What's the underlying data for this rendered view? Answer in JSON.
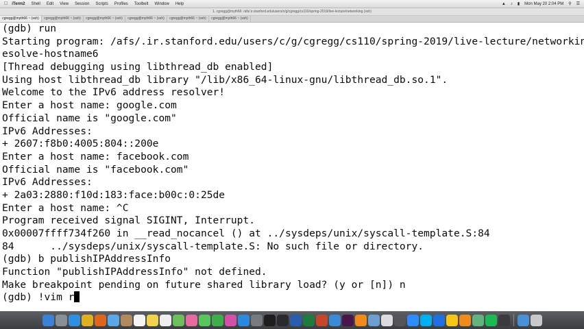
{
  "menubar": {
    "apple": "",
    "items": [
      {
        "label": "iTerm2",
        "name": "menu-iterm2"
      },
      {
        "label": "Shell",
        "name": "menu-shell"
      },
      {
        "label": "Edit",
        "name": "menu-edit"
      },
      {
        "label": "View",
        "name": "menu-view"
      },
      {
        "label": "Session",
        "name": "menu-session"
      },
      {
        "label": "Scripts",
        "name": "menu-scripts"
      },
      {
        "label": "Profiles",
        "name": "menu-profiles"
      },
      {
        "label": "Toolbelt",
        "name": "menu-toolbelt"
      },
      {
        "label": "Window",
        "name": "menu-window"
      },
      {
        "label": "Help",
        "name": "menu-help"
      }
    ],
    "clock": "Mon May 20 2:04 PM"
  },
  "window": {
    "title": "1. cgregg@myth66: /afs/.ir.stanford.edu/users/c/g/cgregg/cs110/spring-2019/live-lecture/networking (ssh)",
    "tabs": [
      {
        "label": "cgregg@myth66 ~ (ssh)"
      },
      {
        "label": "cgregg@myth66 ~ (ssh)"
      },
      {
        "label": "cgregg@myth66 ~ (ssh)"
      },
      {
        "label": "cgregg@myth66 ~ (ssh)"
      },
      {
        "label": "cgregg@myth66 ~ (ssh)"
      },
      {
        "label": "cgregg@myth66 ~ (ssh)"
      }
    ]
  },
  "terminal": {
    "lines": [
      "(gdb) run",
      "Starting program: /afs/.ir.stanford.edu/users/c/g/cgregg/cs110/spring-2019/live-lecture/networking/r",
      "esolve-hostname6",
      "[Thread debugging using libthread_db enabled]",
      "Using host libthread_db library \"/lib/x86_64-linux-gnu/libthread_db.so.1\".",
      "Welcome to the IPv6 address resolver!",
      "Enter a host name: google.com",
      "Official name is \"google.com\"",
      "IPv6 Addresses:",
      "+ 2607:f8b0:4005:804::200e",
      "Enter a host name: facebook.com",
      "Official name is \"facebook.com\"",
      "IPv6 Addresses:",
      "+ 2a03:2880:f10d:183:face:b00c:0:25de",
      "Enter a host name: ^C",
      "Program received signal SIGINT, Interrupt.",
      "0x00007ffff734f260 in __read_nocancel () at ../sysdeps/unix/syscall-template.S:84",
      "84      ../sysdeps/unix/syscall-template.S: No such file or directory.",
      "(gdb) b publishIPAddressInfo",
      "Function \"publishIPAddressInfo\" not defined.",
      "Make breakpoint pending on future shared library load? (y or [n]) n"
    ],
    "prompt_line": "(gdb) !vim r"
  },
  "dock": {
    "icons": [
      {
        "name": "finder-icon",
        "color": "#3b82d6"
      },
      {
        "name": "launchpad-icon",
        "color": "#8a8f96"
      },
      {
        "name": "safari-icon",
        "color": "#2f8fe0"
      },
      {
        "name": "chrome-icon",
        "color": "#e0b020"
      },
      {
        "name": "firefox-icon",
        "color": "#e0661c"
      },
      {
        "name": "mail-icon",
        "color": "#5aa8e8"
      },
      {
        "name": "contacts-icon",
        "color": "#b08a5a"
      },
      {
        "name": "calendar-icon",
        "color": "#f4f4f4"
      },
      {
        "name": "notes-icon",
        "color": "#f2d24a"
      },
      {
        "name": "reminders-icon",
        "color": "#eeeeee"
      },
      {
        "name": "maps-icon",
        "color": "#6cbf5a"
      },
      {
        "name": "photos-icon",
        "color": "#e86aa0"
      },
      {
        "name": "messages-icon",
        "color": "#57c65c"
      },
      {
        "name": "facetime-icon",
        "color": "#3fae4a"
      },
      {
        "name": "itunes-icon",
        "color": "#d64fa8"
      },
      {
        "name": "appstore-icon",
        "color": "#2a8ae0"
      },
      {
        "name": "preferences-icon",
        "color": "#777b80"
      },
      {
        "name": "terminal-icon",
        "color": "#1e1e1e"
      },
      {
        "name": "iterm-icon",
        "color": "#2b2b2b"
      },
      {
        "name": "word-icon",
        "color": "#2a5db0"
      },
      {
        "name": "excel-icon",
        "color": "#1f7a3e"
      },
      {
        "name": "powerpoint-icon",
        "color": "#c8452a"
      },
      {
        "name": "xcode-icon",
        "color": "#3a8ad8"
      },
      {
        "name": "slack-icon",
        "color": "#4a154b"
      },
      {
        "name": "vlc-icon",
        "color": "#f08a1a"
      },
      {
        "name": "preview-icon",
        "color": "#6f9fd0"
      },
      {
        "name": "textedit-icon",
        "color": "#dcdcdc"
      },
      {
        "name": "activity-icon",
        "color": "#55555a"
      },
      {
        "name": "zoom-icon",
        "color": "#2d8cff"
      },
      {
        "name": "skype-icon",
        "color": "#00aff0"
      },
      {
        "name": "dropbox-icon",
        "color": "#1f6fe5"
      },
      {
        "name": "gdrive-icon",
        "color": "#f5c518"
      },
      {
        "name": "sublime-icon",
        "color": "#f08a1a"
      },
      {
        "name": "atom-icon",
        "color": "#5fb57d"
      },
      {
        "name": "spotify-icon",
        "color": "#1db954"
      },
      {
        "name": "quicktime-icon",
        "color": "#3b3b3b"
      }
    ],
    "trailing": [
      {
        "name": "downloads-icon",
        "color": "#4a90d9"
      },
      {
        "name": "trash-icon",
        "color": "#c9c9c9"
      }
    ]
  }
}
